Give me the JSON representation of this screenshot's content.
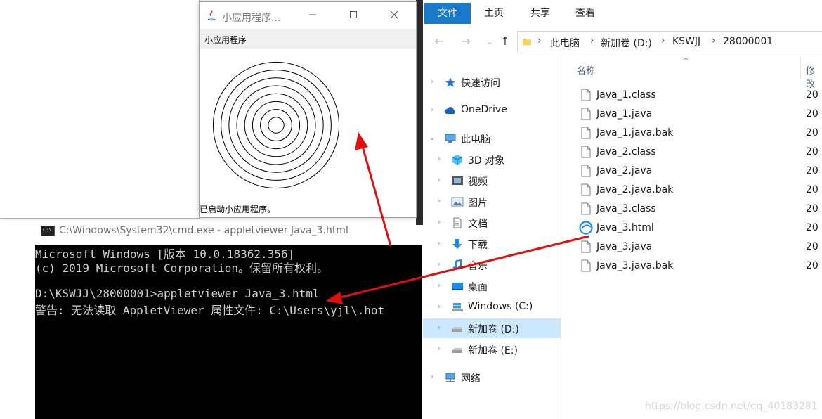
{
  "blank_window": {},
  "applet_window": {
    "title": "小应用程序...",
    "menu_label": "小应用程序",
    "status_text": "已启动小应用程序。",
    "icons": {
      "app": "java-icon",
      "minimize": "minimize-icon",
      "maximize": "maximize-icon",
      "close": "close-icon"
    },
    "rings": 8
  },
  "cmd_window": {
    "title": "C:\\Windows\\System32\\cmd.exe - appletviewer  Java_3.html",
    "lines": [
      "Microsoft Windows [版本 10.0.18362.356]",
      "(c) 2019 Microsoft Corporation。保留所有权利。",
      "",
      "D:\\KSWJJ\\28000001>appletviewer Java_3.html",
      "警告: 无法读取 AppletViewer 属性文件: C:\\Users\\yjl\\.hot"
    ]
  },
  "explorer": {
    "ribbon_tabs": [
      {
        "label": "文件",
        "active": true
      },
      {
        "label": "主页",
        "active": false
      },
      {
        "label": "共享",
        "active": false
      },
      {
        "label": "查看",
        "active": false
      }
    ],
    "address": {
      "back_icon": "←",
      "forward_icon": "→",
      "recent_icon": "⌄",
      "up_icon": "↑",
      "breadcrumbs": [
        "此电脑",
        "新加卷 (D:)",
        "KSWJJ",
        "28000001"
      ],
      "separator": "›"
    },
    "nav_items": [
      {
        "label": "快速访问",
        "icon": "star-icon",
        "indent": 0
      },
      {
        "label": "OneDrive",
        "icon": "cloud-icon",
        "indent": 0
      },
      {
        "label": "此电脑",
        "icon": "computer-icon",
        "indent": 0,
        "expanded": true
      },
      {
        "label": "3D 对象",
        "icon": "cube-icon",
        "indent": 1
      },
      {
        "label": "视频",
        "icon": "video-icon",
        "indent": 1
      },
      {
        "label": "图片",
        "icon": "picture-icon",
        "indent": 1
      },
      {
        "label": "文档",
        "icon": "document-icon",
        "indent": 1
      },
      {
        "label": "下载",
        "icon": "download-icon",
        "indent": 1
      },
      {
        "label": "音乐",
        "icon": "music-icon",
        "indent": 1
      },
      {
        "label": "桌面",
        "icon": "desktop-icon",
        "indent": 1
      },
      {
        "label": "Windows (C:)",
        "icon": "windows-drive-icon",
        "indent": 1
      },
      {
        "label": "新加卷 (D:)",
        "icon": "drive-icon",
        "indent": 1,
        "selected": true
      },
      {
        "label": "新加卷 (E:)",
        "icon": "drive-icon",
        "indent": 1
      },
      {
        "label": "网络",
        "icon": "network-icon",
        "indent": 0
      }
    ],
    "columns": {
      "name": "名称",
      "modified": "修改"
    },
    "files": [
      {
        "name": "Java_1.class",
        "icon": "file-icon",
        "date": "20"
      },
      {
        "name": "Java_1.java",
        "icon": "file-icon",
        "date": "20"
      },
      {
        "name": "Java_1.java.bak",
        "icon": "file-icon",
        "date": "20"
      },
      {
        "name": "Java_2.class",
        "icon": "file-icon",
        "date": "20"
      },
      {
        "name": "Java_2.java",
        "icon": "file-icon",
        "date": "20"
      },
      {
        "name": "Java_2.java.bak",
        "icon": "file-icon",
        "date": "20"
      },
      {
        "name": "Java_3.class",
        "icon": "file-icon",
        "date": "20"
      },
      {
        "name": "Java_3.html",
        "icon": "html-file-icon",
        "date": "20"
      },
      {
        "name": "Java_3.java",
        "icon": "file-icon",
        "date": "20"
      },
      {
        "name": "Java_3.java.bak",
        "icon": "file-icon",
        "date": "20"
      }
    ],
    "watermark": "https://blog.csdn.net/qq_40183281"
  },
  "colors": {
    "accent": "#1979ca",
    "annotation_arrow": "#e01010",
    "selection": "#cce8ff"
  }
}
